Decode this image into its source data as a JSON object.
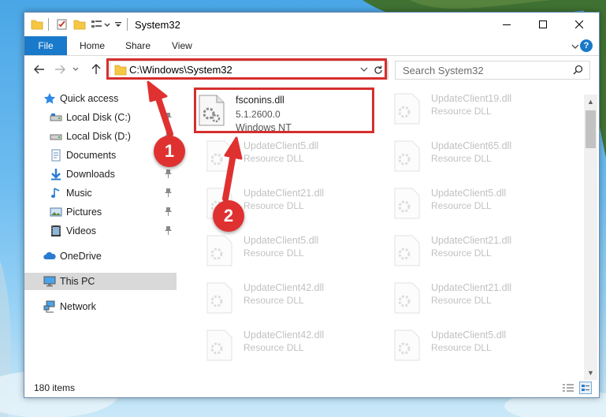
{
  "window": {
    "title": "System32"
  },
  "ribbon": {
    "file": "File",
    "tabs": [
      "Home",
      "Share",
      "View"
    ],
    "help": "?"
  },
  "address": {
    "path": "C:\\Windows\\System32"
  },
  "search": {
    "placeholder": "Search System32"
  },
  "nav": {
    "items": [
      {
        "label": "Quick access",
        "icon": "star-icon",
        "pinned": false
      },
      {
        "label": "Local Disk (C:)",
        "icon": "drive-icon",
        "pinned": true
      },
      {
        "label": "Local Disk (D:)",
        "icon": "drive-icon",
        "pinned": true
      },
      {
        "label": "Documents",
        "icon": "documents-icon",
        "pinned": true
      },
      {
        "label": "Downloads",
        "icon": "download-icon",
        "pinned": true
      },
      {
        "label": "Music",
        "icon": "music-icon",
        "pinned": true
      },
      {
        "label": "Pictures",
        "icon": "pictures-icon",
        "pinned": true
      },
      {
        "label": "Videos",
        "icon": "videos-icon",
        "pinned": true
      },
      {
        "label": "OneDrive",
        "icon": "cloud-icon",
        "pinned": false
      },
      {
        "label": "This PC",
        "icon": "computer-icon",
        "pinned": false,
        "selected": true
      },
      {
        "label": "Network",
        "icon": "network-icon",
        "pinned": false
      }
    ]
  },
  "files": {
    "highlighted": {
      "name": "fsconins.dll",
      "version": "5.1.2600.0",
      "description": "Windows NT"
    },
    "col1": [
      {
        "name": "UpdateClient5.dll",
        "type": "Resource DLL"
      },
      {
        "name": "UpdateClient21.dll",
        "type": "Resource DLL"
      },
      {
        "name": "UpdateClient5.dll",
        "type": "Resource DLL"
      },
      {
        "name": "UpdateClient42.dll",
        "type": "Resource DLL"
      },
      {
        "name": "UpdateClient42.dll",
        "type": "Resource DLL"
      }
    ],
    "col2": [
      {
        "name": "UpdateClient19.dll",
        "type": "Resource DLL"
      },
      {
        "name": "UpdateClient65.dll",
        "type": "Resource DLL"
      },
      {
        "name": "UpdateClient5.dll",
        "type": "Resource DLL"
      },
      {
        "name": "UpdateClient21.dll",
        "type": "Resource DLL"
      },
      {
        "name": "UpdateClient21.dll",
        "type": "Resource DLL"
      },
      {
        "name": "UpdateClient5.dll",
        "type": "Resource DLL"
      }
    ]
  },
  "status": {
    "count": "180 items"
  },
  "annotations": {
    "step1": "1",
    "step2": "2"
  },
  "colors": {
    "accent": "#1979ca",
    "highlight": "#d62e2e",
    "badge": "#e03131"
  }
}
